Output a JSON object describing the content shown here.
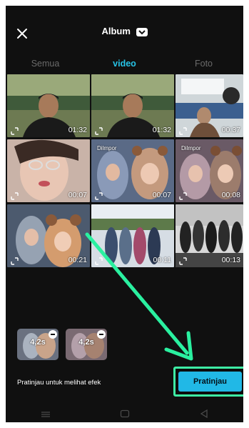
{
  "header": {
    "title": "Album"
  },
  "tabs": [
    {
      "label": "Semua",
      "active": false
    },
    {
      "label": "video",
      "active": true
    },
    {
      "label": "Foto",
      "active": false
    }
  ],
  "grid": [
    {
      "duration": "01:32"
    },
    {
      "duration": "01:32"
    },
    {
      "duration": "00:37"
    },
    {
      "duration": "00:07",
      "tag": ""
    },
    {
      "duration": "00:07",
      "tag": "Dilmpor"
    },
    {
      "duration": "00:08",
      "tag": "Dilmpor"
    },
    {
      "duration": "00:21"
    },
    {
      "duration": "00:11"
    },
    {
      "duration": "00:13"
    }
  ],
  "selected": [
    {
      "length": "4,2s"
    },
    {
      "length": "4,2s"
    }
  ],
  "footer": {
    "hint": "Pratinjau untuk melihat efek",
    "preview_label": "Pratinjau"
  },
  "colors": {
    "accent": "#27c3e6",
    "highlight": "#3ef0a5",
    "background": "#101010"
  }
}
